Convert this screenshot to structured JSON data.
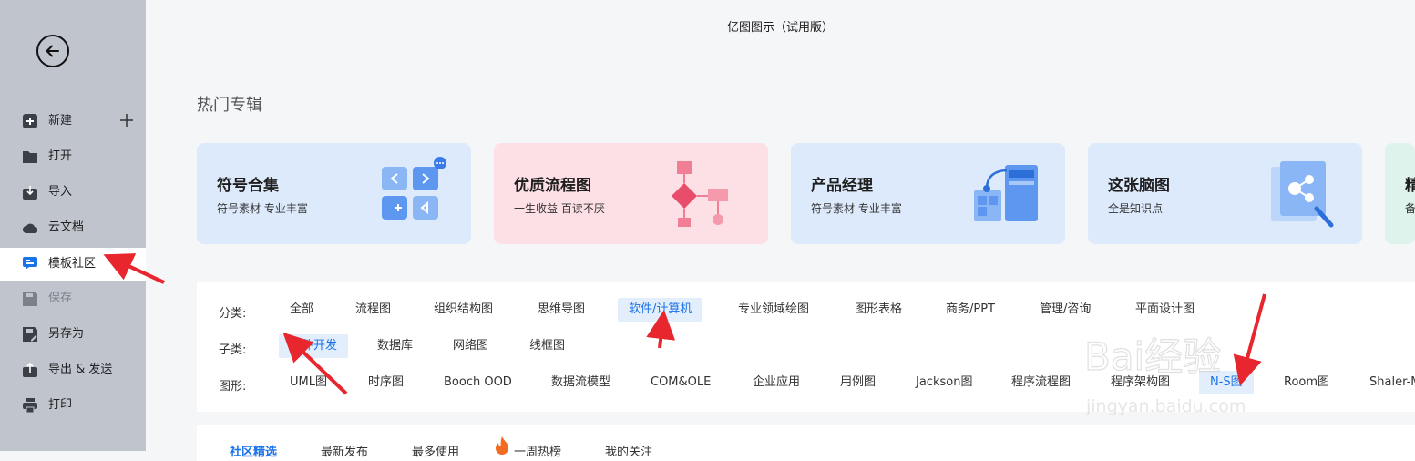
{
  "window": {
    "title": "亿图图示（试用版）"
  },
  "sidebar": {
    "back_icon": "arrow-left-icon",
    "items": [
      {
        "label": "新建",
        "icon": "plus-square-icon"
      },
      {
        "label": "打开",
        "icon": "folder-icon"
      },
      {
        "label": "导入",
        "icon": "import-icon"
      },
      {
        "label": "云文档",
        "icon": "cloud-icon"
      },
      {
        "label": "模板社区",
        "icon": "template-community-icon"
      },
      {
        "label": "保存",
        "icon": "save-icon"
      },
      {
        "label": "另存为",
        "icon": "save-as-icon"
      },
      {
        "label": "导出 & 发送",
        "icon": "export-icon"
      },
      {
        "label": "打印",
        "icon": "printer-icon"
      }
    ],
    "active_item": "模板社区",
    "disabled_item": "保存"
  },
  "hot_topics": {
    "title": "热门专辑",
    "cards": [
      {
        "title": "符号合集",
        "subtitle": "符号素材 专业丰富",
        "bg": "#ddeafc"
      },
      {
        "title": "优质流程图",
        "subtitle": "一生收益 百读不厌",
        "bg": "#fde0e6"
      },
      {
        "title": "产品经理",
        "subtitle": "符号素材 专业丰富",
        "bg": "#ddeafc"
      },
      {
        "title": "这张脑图",
        "subtitle": "全是知识点",
        "bg": "#ddeafc"
      },
      {
        "title": "精",
        "subtitle": "备",
        "bg": "#ddf3ec"
      }
    ]
  },
  "filters": {
    "category": {
      "label": "分类:",
      "options": [
        "全部",
        "流程图",
        "组织结构图",
        "思维导图",
        "软件/计算机",
        "专业领域绘图",
        "图形表格",
        "商务/PPT",
        "管理/咨询",
        "平面设计图"
      ],
      "selected": "软件/计算机"
    },
    "subcategory": {
      "label": "子类:",
      "options": [
        "软件开发",
        "数据库",
        "网络图",
        "线框图"
      ],
      "selected": "软件开发"
    },
    "shape": {
      "label": "图形:",
      "options": [
        "UML图",
        "时序图",
        "Booch OOD",
        "数据流模型",
        "COM&OLE",
        "企业应用",
        "用例图",
        "Jackson图",
        "程序流程图",
        "程序架构图",
        "N-S图",
        "Room图",
        "Shaler-M"
      ],
      "selected": "N-S图"
    }
  },
  "tabs": {
    "items": [
      "社区精选",
      "最新发布",
      "最多使用",
      "一周热榜",
      "我的关注"
    ],
    "selected": "社区精选"
  },
  "watermark": {
    "text": "Bai经验",
    "sub": "jingyan.baidu.com"
  },
  "colors": {
    "accent": "#1a73e8",
    "annotation": "#e8262d"
  }
}
